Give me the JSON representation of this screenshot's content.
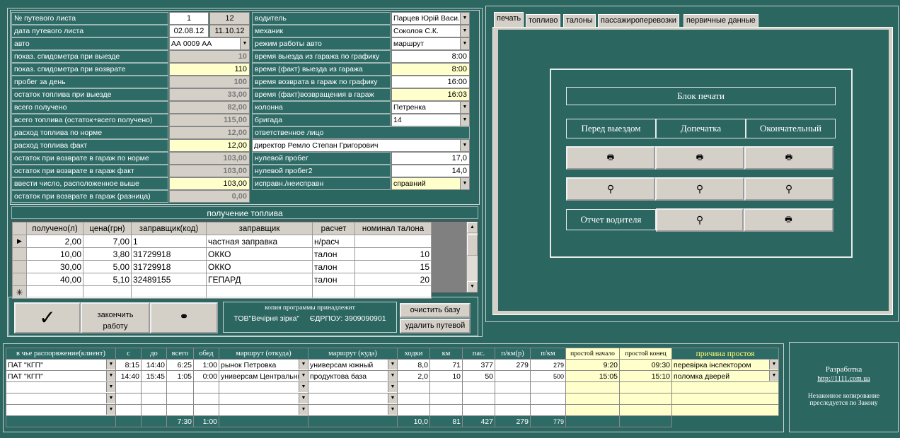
{
  "form": {
    "rows_left": [
      {
        "label": "№ путевого листа",
        "v1": "1",
        "v2": "12"
      },
      {
        "label": "дата путевого листа",
        "v1": "02.08.12",
        "v2": "11.10.12"
      },
      {
        "label": "авто",
        "value": "АА 0009 АА"
      },
      {
        "label": "показ. спидометра при выезде",
        "value": "10"
      },
      {
        "label": "показ. спидометра при возврате",
        "value": "110"
      },
      {
        "label": "пробег за день",
        "value": "100"
      },
      {
        "label": "остаток топлива при выезде",
        "value": "33,00"
      },
      {
        "label": "всего получено",
        "value": "82,00"
      },
      {
        "label": "всего топлива (остаток+всего получено)",
        "value": "115,00"
      },
      {
        "label": "расход топлива по норме",
        "value": "12,00"
      },
      {
        "label": "расход топлива факт",
        "value": "12,00"
      },
      {
        "label": "остаток при возврате в гараж по норме",
        "value": "103,00"
      },
      {
        "label": "остаток при возврате в гараж  факт",
        "value": "103,00"
      },
      {
        "label": "ввести число, расположенное выше",
        "value": "103,00"
      },
      {
        "label": "остаток при возврате в гараж (разница)",
        "value": "0,00"
      }
    ],
    "rows_right": [
      {
        "label": "водитель",
        "value": "Парцев Юрій Васи."
      },
      {
        "label": "механик",
        "value": "Соколов С.К."
      },
      {
        "label": "режим работы авто",
        "value": "маршрут"
      },
      {
        "label": "время выезда из гаража по графику",
        "value": "8:00"
      },
      {
        "label": "время (факт) выезда из гаража",
        "value": "8:00"
      },
      {
        "label": "время возврата в гараж по графику",
        "value": "16:00"
      },
      {
        "label": "время (факт)возвращения в гараж",
        "value": "16:03"
      },
      {
        "label": "колонна",
        "value": "Петренка"
      },
      {
        "label": "бригада",
        "value": "14"
      },
      {
        "label": "ответственное лицо",
        "value": ""
      },
      {
        "label": "",
        "value": "директор Ремло Степан Григорович"
      },
      {
        "label": "нулевой пробег",
        "value": "17,0"
      },
      {
        "label": "нулевой пробег2",
        "value": "14,0"
      },
      {
        "label": "исправн./неисправн",
        "value": "справний"
      }
    ]
  },
  "fuel": {
    "title": "получение топлива",
    "headers": [
      "получено(л)",
      "цена(грн)",
      "заправщик(код)",
      "заправщик",
      "расчет",
      "номинал талона"
    ],
    "rows": [
      [
        "2,00",
        "7,00",
        "1",
        "частная заправка",
        "н/расч",
        ""
      ],
      [
        "10,00",
        "3,80",
        "31729918",
        "ОККО",
        "талон",
        "10"
      ],
      [
        "30,00",
        "5,00",
        "31729918",
        "ОККО",
        "талон",
        "15"
      ],
      [
        "40,00",
        "5,10",
        "32489155",
        "ГЕПАРД",
        "талон",
        "20"
      ]
    ]
  },
  "actions": {
    "finish_label": "закончить работу",
    "owner_line1": "копия программы принадлежит",
    "owner_line2": "ТОВ\"Вечірня зірка\"     ЄДРПОУ: 3909090901",
    "clear_db": "очистить базу",
    "delete_sheet": "удалить путевой"
  },
  "tabs": [
    "печать",
    "топливо",
    "талоны",
    "пассажироперевозки",
    "первичные данные"
  ],
  "print": {
    "title": "Блок печати",
    "col1": "Перед выездом",
    "col2": "Допечатка",
    "col3": "Окончательный",
    "driver_report": "Отчет водителя"
  },
  "routes": {
    "headers": [
      "в чье распоряжение(клиент)",
      "с",
      "до",
      "всего",
      "обед",
      "маршрут (откуда)",
      "маршрут (куда)",
      "ходки",
      "км",
      "пас.",
      "п/км(р)",
      "п/км",
      "простой начало",
      "простой конец",
      "причина простоя"
    ],
    "rows": [
      [
        "ПАТ \"КГП\"",
        "8:15",
        "14:40",
        "6:25",
        "1:00",
        "рынок Петровка",
        "универсам южный",
        "8,0",
        "71",
        "377",
        "279",
        "279",
        "9:20",
        "09:30",
        "перевірка інспектором"
      ],
      [
        "ПАТ \"КГП\"",
        "14:40",
        "15:45",
        "1:05",
        "0:00",
        "универсам Центральный",
        "продуктова база",
        "2,0",
        "10",
        "50",
        "",
        "500",
        "15:05",
        "15:10",
        "поломка дверей"
      ]
    ],
    "totals": {
      "all": "7:30",
      "lunch": "1:00",
      "trips": "10,0",
      "km": "81",
      "pas": "427",
      "pkmr": "279",
      "pkm": "779"
    }
  },
  "credits": {
    "line1": "Разработка",
    "link": "http://1111.com.ua",
    "line2": "Незаконное копирование",
    "line3": "преследуется по Закону"
  }
}
